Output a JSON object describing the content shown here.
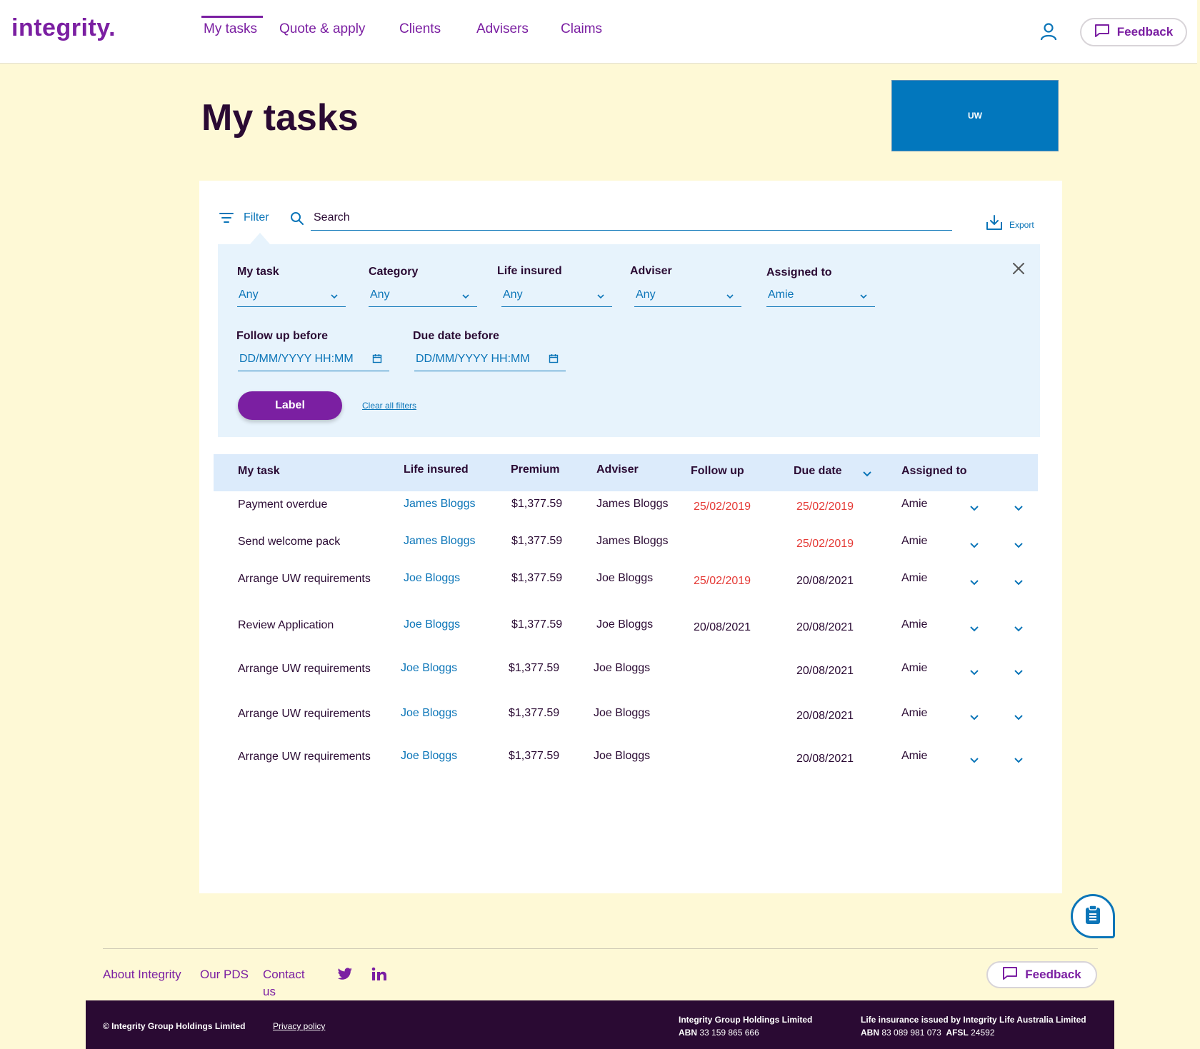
{
  "header": {
    "logo": "integrity.",
    "nav": [
      "My tasks",
      "Quote & apply",
      "Clients",
      "Advisers",
      "Claims"
    ],
    "active_nav": "My tasks",
    "feedback_label": "Feedback"
  },
  "page": {
    "title": "My tasks",
    "uw_badge": "UW"
  },
  "toolbar": {
    "filter_label": "Filter",
    "search_placeholder": "Search",
    "export_label": "Export"
  },
  "filters": {
    "my_task": {
      "label": "My task",
      "value": "Any"
    },
    "category": {
      "label": "Category",
      "value": "Any"
    },
    "life_insured": {
      "label": "Life insured",
      "value": "Any"
    },
    "adviser": {
      "label": "Adviser",
      "value": "Any"
    },
    "assigned_to": {
      "label": "Assigned to",
      "value": "Amie"
    },
    "follow_up_before": {
      "label": "Follow up before",
      "placeholder": "DD/MM/YYYY HH:MM"
    },
    "due_date_before": {
      "label": "Due date before",
      "placeholder": "DD/MM/YYYY HH:MM"
    },
    "apply_label": "Label",
    "clear_label": "Clear all filters"
  },
  "table": {
    "headers": {
      "my_task": "My task",
      "life_insured": "Life insured",
      "premium": "Premium",
      "adviser": "Adviser",
      "follow_up": "Follow up",
      "due_date": "Due date",
      "assigned_to": "Assigned to"
    },
    "rows": [
      {
        "task": "Payment overdue",
        "life": "James Bloggs",
        "premium": "$1,377.59",
        "adviser": "James Bloggs",
        "follow": "25/02/2019",
        "due": "25/02/2019",
        "assigned": "Amie"
      },
      {
        "task": "Send welcome pack",
        "life": "James Bloggs",
        "premium": "$1,377.59",
        "adviser": "James Bloggs",
        "follow": "",
        "due": "25/02/2019",
        "assigned": "Amie"
      },
      {
        "task": "Arrange UW requirements",
        "life": "Joe Bloggs",
        "premium": "$1,377.59",
        "adviser": "Joe Bloggs",
        "follow": "25/02/2019",
        "due": "20/08/2021",
        "assigned": "Amie"
      },
      {
        "task": "Review Application",
        "life": "Joe Bloggs",
        "premium": "$1,377.59",
        "adviser": "Joe Bloggs",
        "follow": "20/08/2021",
        "due": "20/08/2021",
        "assigned": "Amie"
      },
      {
        "task": "Arrange UW requirements",
        "life": "Joe Bloggs",
        "premium": "$1,377.59",
        "adviser": "Joe Bloggs",
        "follow": "",
        "due": "20/08/2021",
        "assigned": "Amie"
      },
      {
        "task": "Arrange UW requirements",
        "life": "Joe Bloggs",
        "premium": "$1,377.59",
        "adviser": "Joe Bloggs",
        "follow": "",
        "due": "20/08/2021",
        "assigned": "Amie"
      },
      {
        "task": "Arrange UW requirements",
        "life": "Joe Bloggs",
        "premium": "$1,377.59",
        "adviser": "Joe Bloggs",
        "follow": "",
        "due": "20/08/2021",
        "assigned": "Amie"
      }
    ]
  },
  "footer": {
    "links": [
      "About Integrity",
      "Our PDS",
      "Contact us"
    ],
    "feedback_label": "Feedback",
    "copyright": "© Integrity Group Holdings Limited",
    "privacy": "Privacy policy",
    "company_name": "Integrity Group Holdings Limited",
    "company_abn_label": "ABN",
    "company_abn": "33 159 865 666",
    "insurer_name": "Life insurance issued by Integrity Life Australia Limited",
    "insurer_abn_label": "ABN",
    "insurer_abn": "83 089 981 073",
    "insurer_afsl_label": "AFSL",
    "insurer_afsl": "24592"
  },
  "colors": {
    "brand_purple": "#7b1fa2",
    "link_blue": "#0b75b8",
    "overdue_red": "#e53935",
    "page_bg": "#fef9d6",
    "dark_footer": "#2a0a33"
  }
}
